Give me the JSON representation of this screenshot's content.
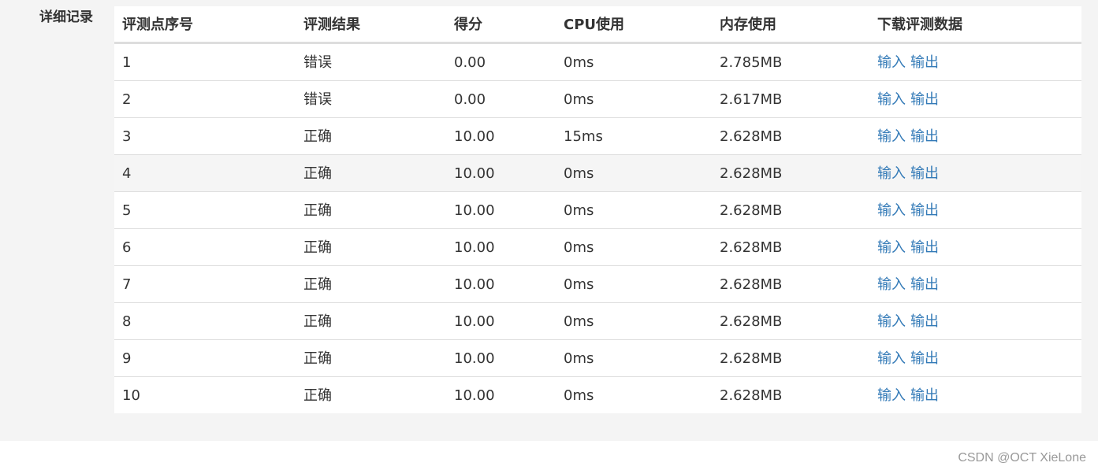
{
  "section": {
    "label": "详细记录"
  },
  "table": {
    "headers": [
      "评测点序号",
      "评测结果",
      "得分",
      "CPU使用",
      "内存使用",
      "下载评测数据"
    ],
    "rows": [
      {
        "index": "1",
        "result": "错误",
        "score": "0.00",
        "cpu": "0ms",
        "memory": "2.785MB",
        "input": "输入",
        "output": "输出"
      },
      {
        "index": "2",
        "result": "错误",
        "score": "0.00",
        "cpu": "0ms",
        "memory": "2.617MB",
        "input": "输入",
        "output": "输出"
      },
      {
        "index": "3",
        "result": "正确",
        "score": "10.00",
        "cpu": "15ms",
        "memory": "2.628MB",
        "input": "输入",
        "output": "输出"
      },
      {
        "index": "4",
        "result": "正确",
        "score": "10.00",
        "cpu": "0ms",
        "memory": "2.628MB",
        "input": "输入",
        "output": "输出"
      },
      {
        "index": "5",
        "result": "正确",
        "score": "10.00",
        "cpu": "0ms",
        "memory": "2.628MB",
        "input": "输入",
        "output": "输出"
      },
      {
        "index": "6",
        "result": "正确",
        "score": "10.00",
        "cpu": "0ms",
        "memory": "2.628MB",
        "input": "输入",
        "output": "输出"
      },
      {
        "index": "7",
        "result": "正确",
        "score": "10.00",
        "cpu": "0ms",
        "memory": "2.628MB",
        "input": "输入",
        "output": "输出"
      },
      {
        "index": "8",
        "result": "正确",
        "score": "10.00",
        "cpu": "0ms",
        "memory": "2.628MB",
        "input": "输入",
        "output": "输出"
      },
      {
        "index": "9",
        "result": "正确",
        "score": "10.00",
        "cpu": "0ms",
        "memory": "2.628MB",
        "input": "输入",
        "output": "输出"
      },
      {
        "index": "10",
        "result": "正确",
        "score": "10.00",
        "cpu": "0ms",
        "memory": "2.628MB",
        "input": "输入",
        "output": "输出"
      }
    ]
  },
  "colors": {
    "link": "#337ab7",
    "panel_background": "#f4f4f4",
    "hover_row": "#f5f5f5"
  },
  "watermark": {
    "text": "CSDN @OCT XieLone"
  }
}
